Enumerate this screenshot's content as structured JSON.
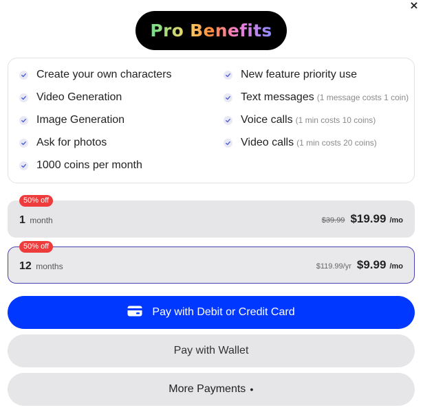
{
  "close_icon": "×",
  "title": "Pro Benefits",
  "benefits": {
    "left": [
      {
        "label": "Create your own characters"
      },
      {
        "label": "Video Generation"
      },
      {
        "label": "Image Generation"
      },
      {
        "label": "Ask for photos"
      },
      {
        "label": "1000 coins per month"
      }
    ],
    "right": [
      {
        "label": "New feature priority use",
        "note": ""
      },
      {
        "label": "Text messages",
        "note": "(1 message costs 1 coin)"
      },
      {
        "label": "Voice calls",
        "note": "(1 min costs 10 coins)"
      },
      {
        "label": "Video calls",
        "note": "(1 min costs 20 coins)"
      }
    ]
  },
  "plans": [
    {
      "badge": "50% off",
      "count": "1",
      "unit": "month",
      "old_price": "$39.99",
      "price": "$19.99",
      "per": "/mo",
      "selected": false
    },
    {
      "badge": "50% off",
      "count": "12",
      "unit": "months",
      "old_price": "$119.99/yr",
      "price": "$9.99",
      "per": "/mo",
      "selected": true
    }
  ],
  "buttons": {
    "card": "Pay with Debit or Credit Card",
    "wallet": "Pay with Wallet",
    "more": "More Payments"
  },
  "colors": {
    "primary": "#0038ff",
    "badge": "#ee3b3b",
    "selected_border": "#4a3fb2"
  }
}
